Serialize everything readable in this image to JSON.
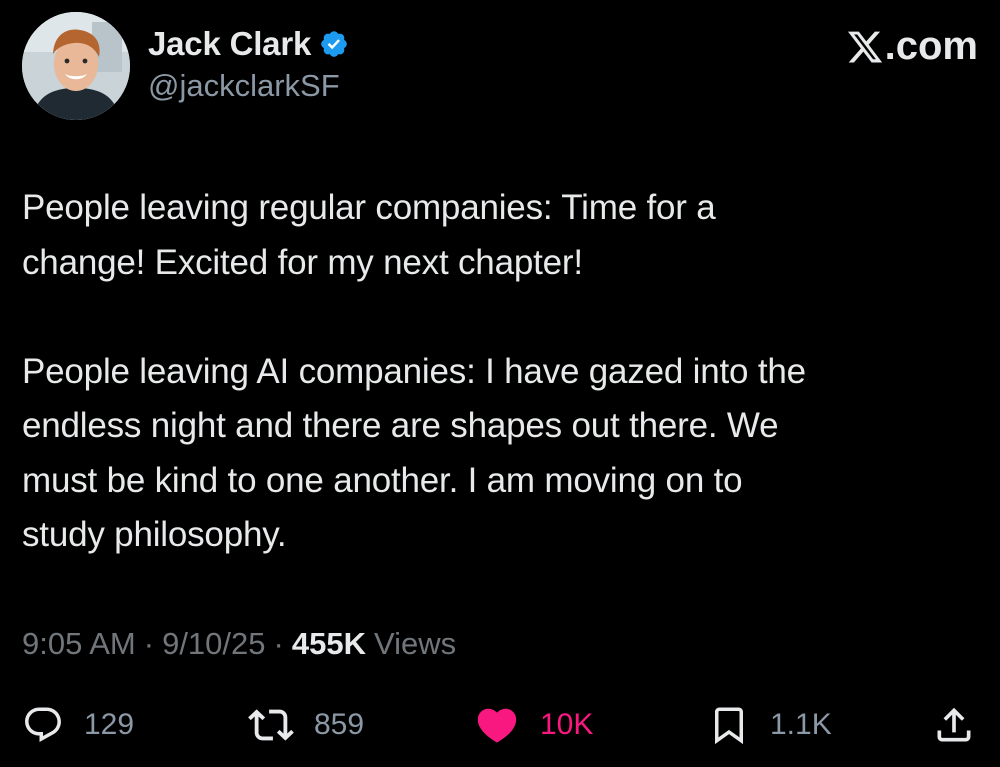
{
  "author": {
    "name": "Jack Clark",
    "handle": "@jackclarkSF",
    "verified_icon": "verified-badge-icon",
    "verified_color": "#1d9bf0"
  },
  "site": {
    "label": ".com",
    "logo_icon": "x-logo-icon"
  },
  "tweet": {
    "paragraphs": [
      [
        "People leaving regular companies: Time for a",
        "change! Excited for my next chapter!"
      ],
      [
        "People leaving AI companies: I have gazed into the",
        "endless night and there are shapes out there. We",
        "must be kind to one another. I am moving on to",
        "study philosophy."
      ]
    ]
  },
  "meta": {
    "time": "9:05 AM",
    "separator": "·",
    "date": "9/10/25",
    "views_count": "455K",
    "views_label": "Views"
  },
  "actions": {
    "reply": {
      "icon": "reply-icon",
      "count": "129"
    },
    "retweet": {
      "icon": "retweet-icon",
      "count": "859"
    },
    "like": {
      "icon": "heart-icon",
      "count": "10K",
      "color": "#f91880"
    },
    "bookmark": {
      "icon": "bookmark-icon",
      "count": "1.1K"
    },
    "share": {
      "icon": "share-icon"
    }
  },
  "colors": {
    "background": "#000000",
    "text": "#e7e9ea",
    "secondary": "#71767b",
    "like": "#f91880",
    "verified": "#1d9bf0"
  }
}
